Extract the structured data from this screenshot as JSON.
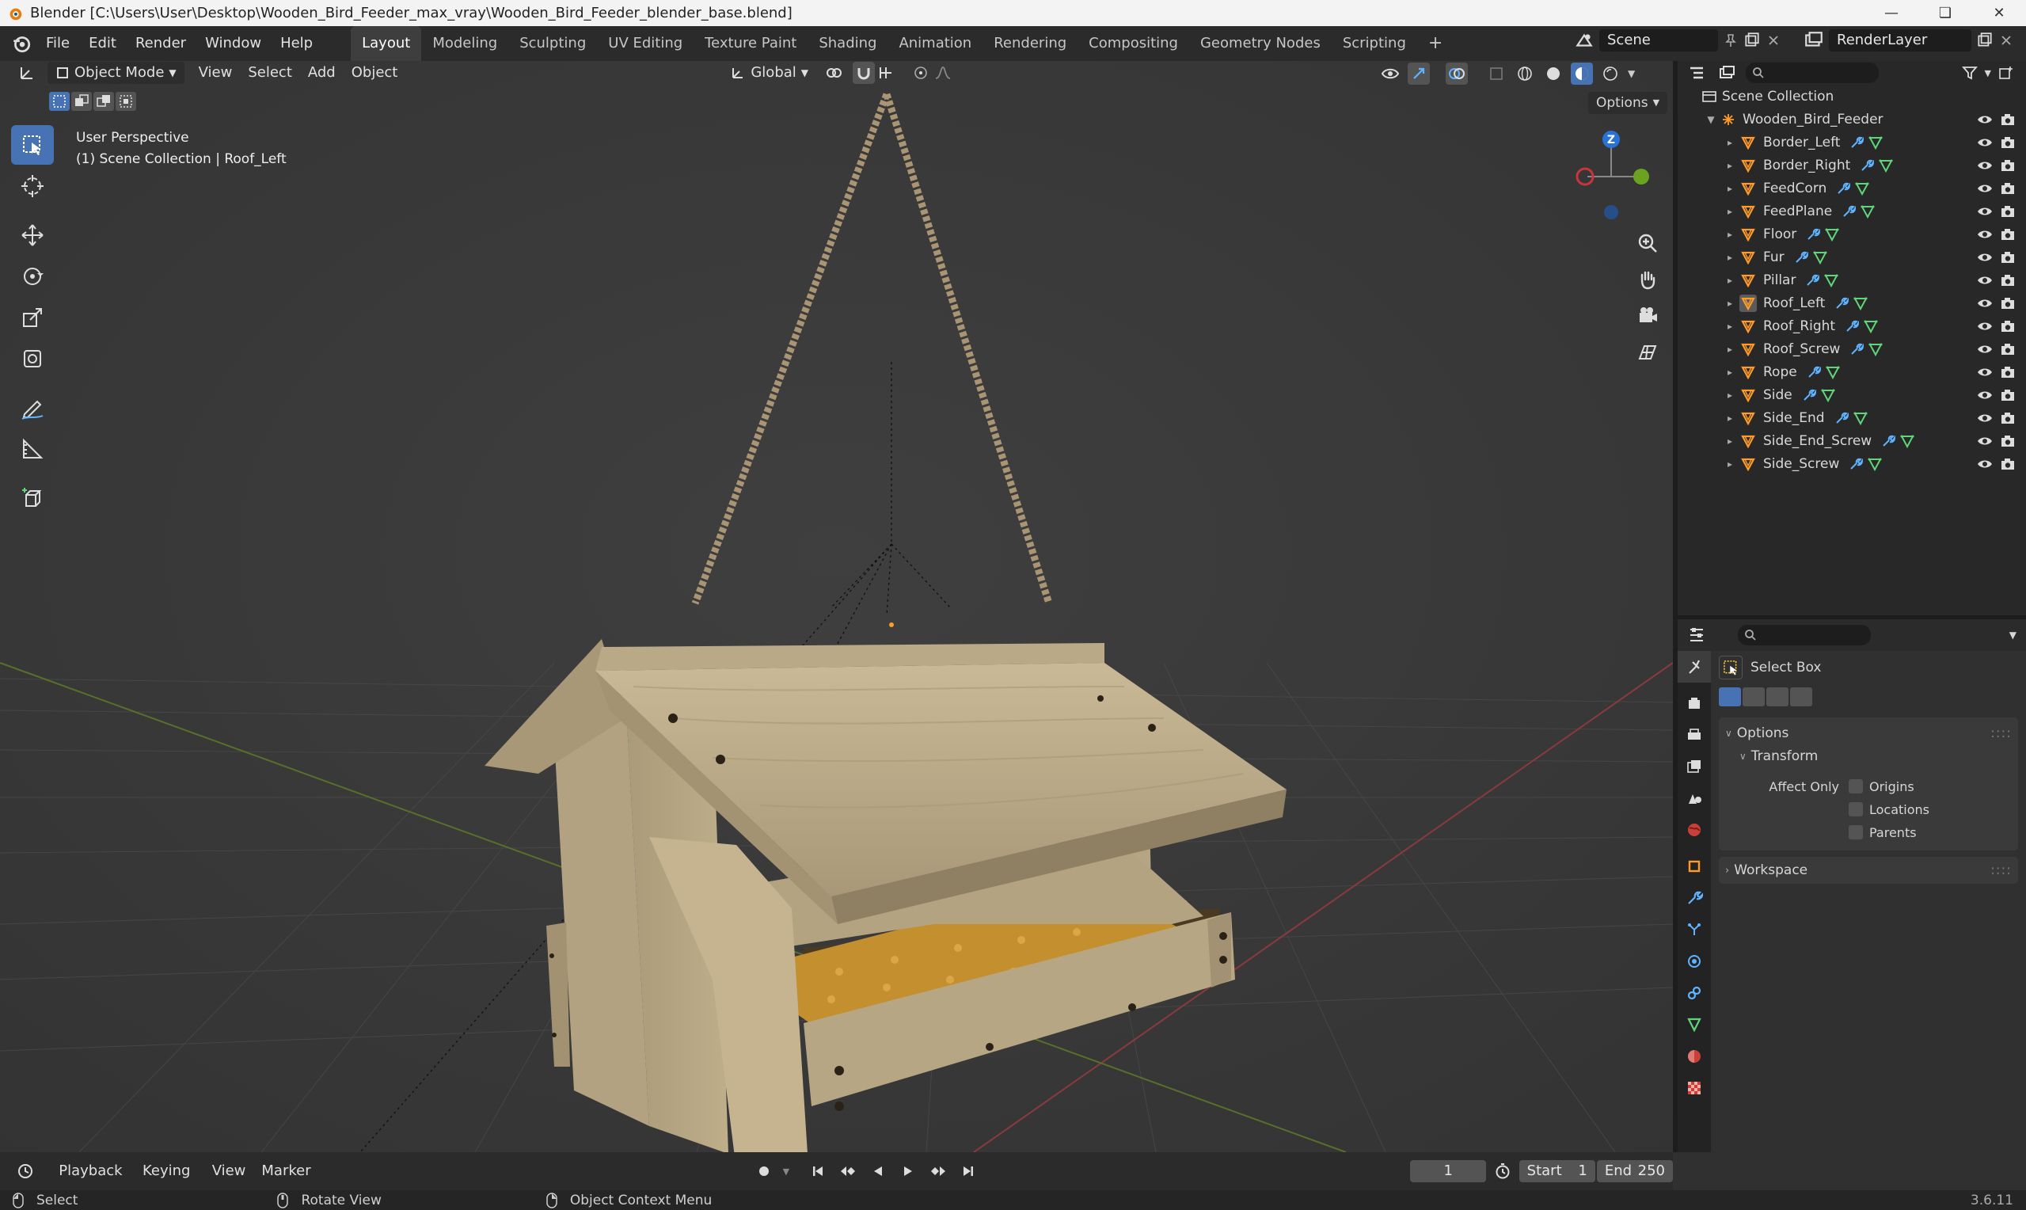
{
  "window": {
    "title": "Blender [C:\\Users\\User\\Desktop\\Wooden_Bird_Feeder_max_vray\\Wooden_Bird_Feeder_blender_base.blend]"
  },
  "menu": [
    "File",
    "Edit",
    "Render",
    "Window",
    "Help"
  ],
  "workspaces": [
    "Layout",
    "Modeling",
    "Sculpting",
    "UV Editing",
    "Texture Paint",
    "Shading",
    "Animation",
    "Rendering",
    "Compositing",
    "Geometry Nodes",
    "Scripting"
  ],
  "active_workspace": "Layout",
  "scene": {
    "name": "Scene",
    "render_layer": "RenderLayer"
  },
  "viewport": {
    "mode": "Object Mode",
    "menus": [
      "View",
      "Select",
      "Add",
      "Object"
    ],
    "transform_orientation": "Global",
    "options_label": "Options",
    "perspective_text": "User Perspective",
    "collection_text": "(1) Scene Collection | Roof_Left",
    "gizmo_z": "Z"
  },
  "outliner": {
    "root": "Scene Collection",
    "collection": "Wooden_Bird_Feeder",
    "objects": [
      "Border_Left",
      "Border_Right",
      "FeedCorn",
      "FeedPlane",
      "Floor",
      "Fur",
      "Pillar",
      "Roof_Left",
      "Roof_Right",
      "Roof_Screw",
      "Rope",
      "Side",
      "Side_End",
      "Side_End_Screw",
      "Side_Screw"
    ],
    "active_object": "Roof_Left"
  },
  "properties": {
    "tool_name": "Select Box",
    "options_label": "Options",
    "transform_label": "Transform",
    "affect_only_label": "Affect Only",
    "checkboxes": [
      "Origins",
      "Locations",
      "Parents"
    ],
    "workspace_label": "Workspace"
  },
  "timeline": {
    "menus": [
      "Playback",
      "Keying",
      "View",
      "Marker"
    ],
    "current_frame": "1",
    "start_label": "Start",
    "start": "1",
    "end_label": "End",
    "end": "250"
  },
  "status": {
    "select": "Select",
    "rotate": "Rotate View",
    "context": "Object Context Menu",
    "version": "3.6.11"
  },
  "colors": {
    "accent": "#4772b3",
    "axis_x": "#c8343f",
    "axis_y": "#6aa31f",
    "axis_z": "#2a73d6",
    "wood": "#b9a886"
  }
}
